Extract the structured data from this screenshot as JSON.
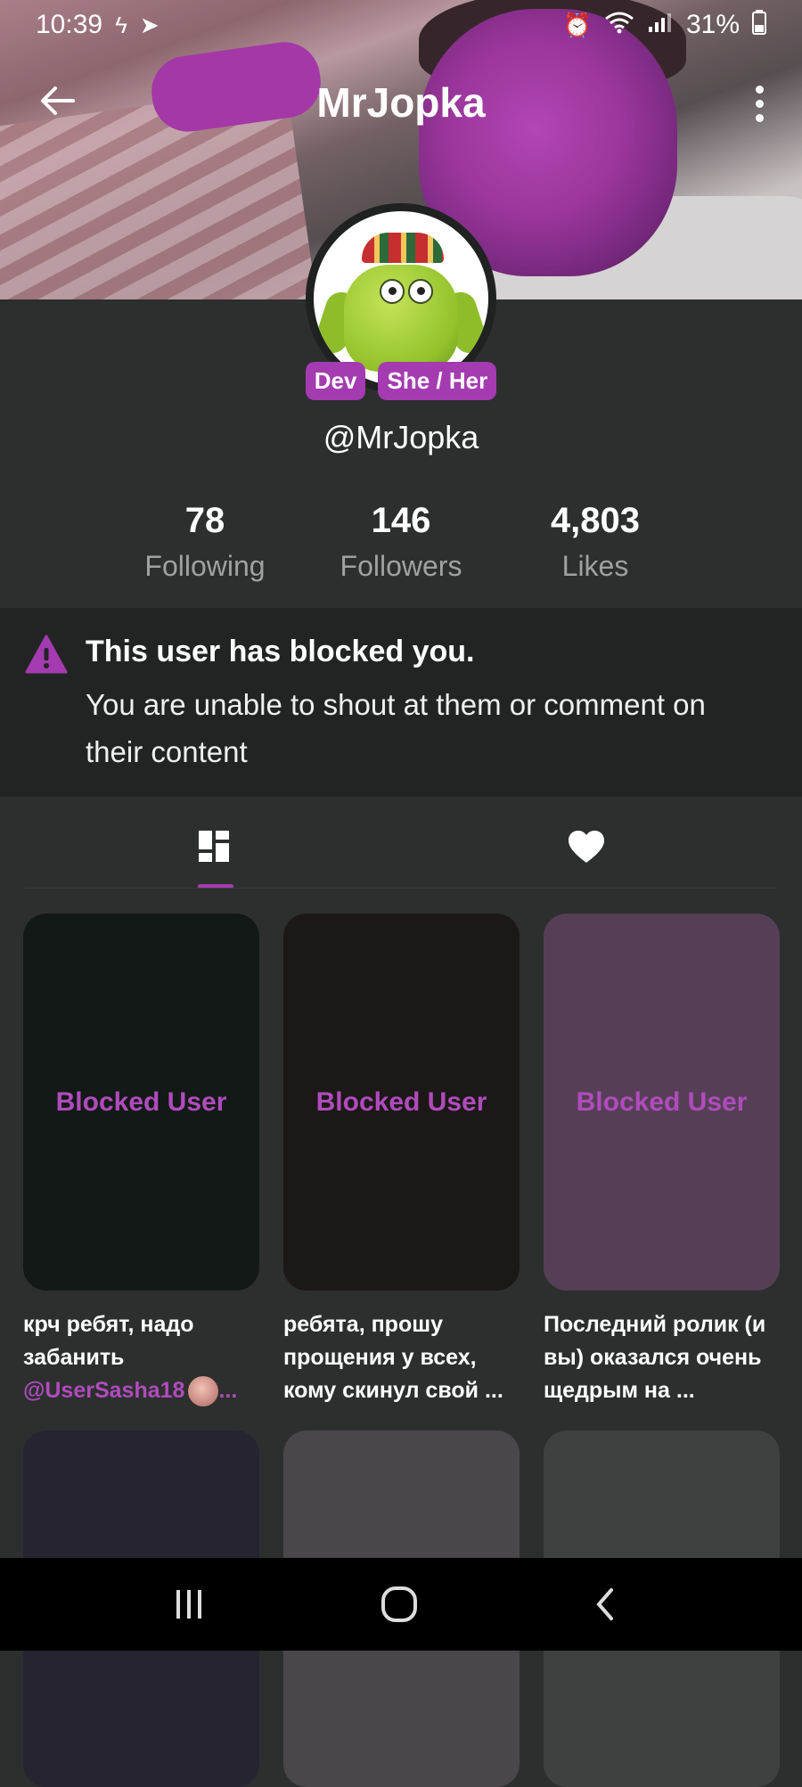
{
  "status_bar": {
    "time": "10:39",
    "battery": "31%"
  },
  "header": {
    "title": "MrJopka"
  },
  "profile": {
    "badges": [
      "Dev",
      "She / Her"
    ],
    "handle": "@MrJopka",
    "stats": [
      {
        "value": "78",
        "label": "Following"
      },
      {
        "value": "146",
        "label": "Followers"
      },
      {
        "value": "4,803",
        "label": "Likes"
      }
    ]
  },
  "blocked_notice": {
    "title": "This user has blocked you.",
    "description": "You are unable to shout at them or comment on their content"
  },
  "tabs": {
    "items": [
      "posts-grid-icon",
      "heart-icon"
    ],
    "active_index": 0,
    "accent_color": "#a43bb0"
  },
  "posts": [
    {
      "label": "Blocked User",
      "caption": "крч ребят, надо забанить",
      "mention": "@UserSasha18",
      "card_color": "#131917"
    },
    {
      "label": "Blocked User",
      "caption": "ребята, прошу прощения у всех, кому скинул свой ...",
      "card_color": "#1c1817"
    },
    {
      "label": "Blocked User",
      "caption": "Последний ролик (и вы) оказался очень щедрым на ...",
      "card_color": "#563f56"
    }
  ],
  "posts_row2_colors": [
    "#252430",
    "#4a474b",
    "#3f4040"
  ]
}
